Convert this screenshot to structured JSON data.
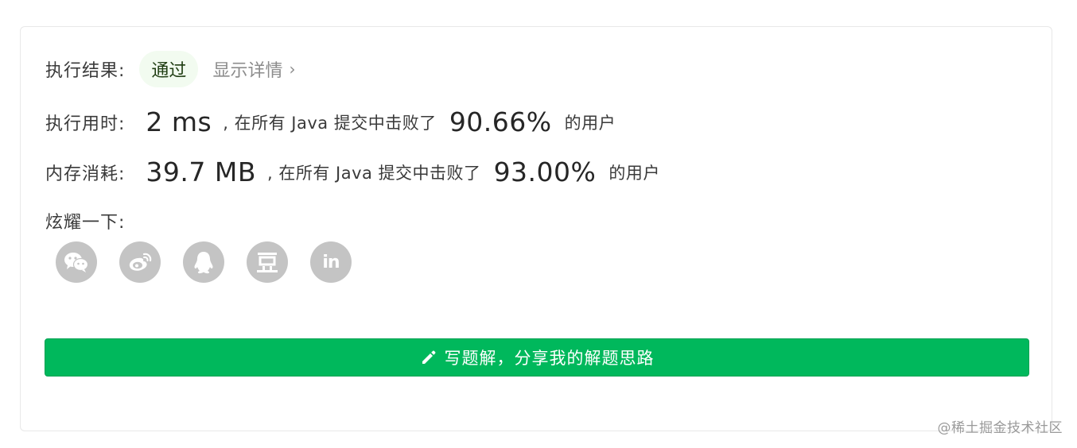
{
  "result": {
    "label": "执行结果:",
    "status": "通过",
    "details_link": "显示详情",
    "details_chevron": "›"
  },
  "runtime": {
    "label": "执行用时:",
    "value": "2 ms",
    "prefix": ", 在所有 Java 提交中击败了",
    "percent": "90.66%",
    "suffix": "的用户"
  },
  "memory": {
    "label": "内存消耗:",
    "value": "39.7 MB",
    "prefix": ", 在所有 Java 提交中击败了",
    "percent": "93.00%",
    "suffix": "的用户"
  },
  "share": {
    "label": "炫耀一下:",
    "items": [
      {
        "icon": "wechat-icon"
      },
      {
        "icon": "weibo-icon"
      },
      {
        "icon": "qq-icon"
      },
      {
        "icon": "douban-icon",
        "glyph": "豆"
      },
      {
        "icon": "linkedin-icon",
        "glyph": "in"
      }
    ]
  },
  "cta": {
    "label": "写题解，分享我的解题思路",
    "icon": "pencil-icon"
  },
  "watermark": "@稀土掘金技术社区",
  "colors": {
    "accent": "#00b85c",
    "pass_bg": "#f2fbf0",
    "icon_gray": "#c4c4c4"
  }
}
